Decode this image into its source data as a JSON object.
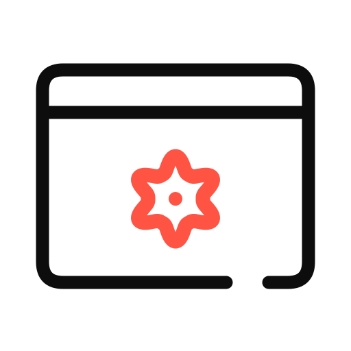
{
  "icon": {
    "name": "browser-window-settings-icon",
    "parts": [
      "browser-window-icon",
      "gear-icon"
    ]
  },
  "colors": {
    "background": "#ffffff",
    "outline": "#0d0d0d",
    "accent": "#ff5443"
  }
}
